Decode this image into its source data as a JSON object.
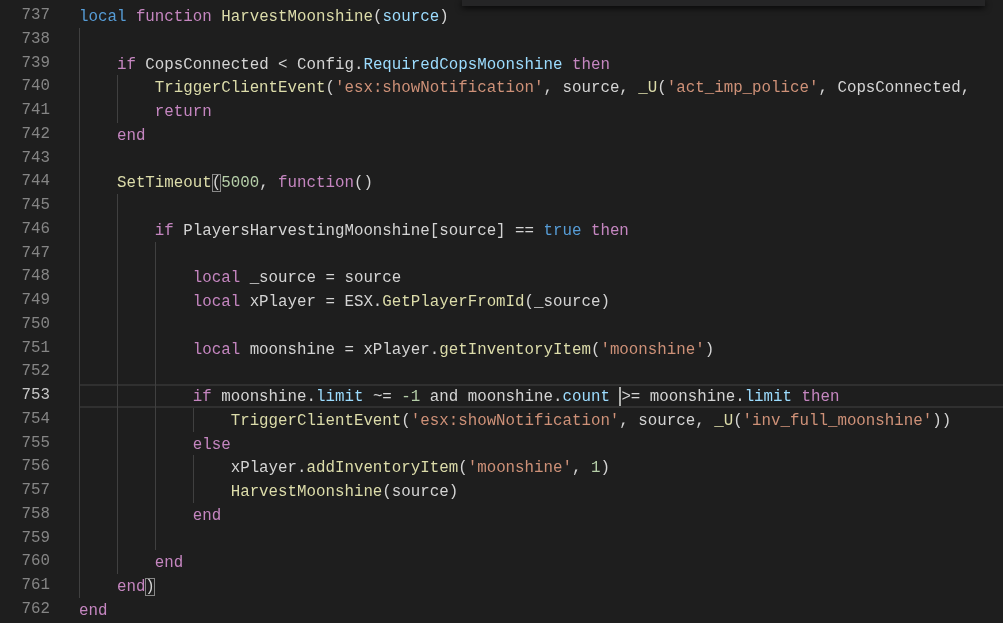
{
  "editor": {
    "lines": [
      {
        "number": "737",
        "current": false,
        "tokens": [
          {
            "text": "local ",
            "kind": "storage"
          },
          {
            "text": "function ",
            "kind": "kw"
          },
          {
            "text": "HarvestMoonshine",
            "kind": "fn"
          },
          {
            "text": "(",
            "kind": "plain"
          },
          {
            "text": "source",
            "kind": "prop"
          },
          {
            "text": ")",
            "kind": "plain"
          }
        ]
      },
      {
        "number": "738",
        "current": false
      },
      {
        "number": "739",
        "current": false,
        "tokens": [
          {
            "text": "    if",
            "kind": "kw"
          },
          {
            "text": " CopsConnected < Config.",
            "kind": "plain"
          },
          {
            "text": "RequiredCopsMoonshine",
            "kind": "prop"
          },
          {
            "text": " then",
            "kind": "kw"
          }
        ]
      },
      {
        "number": "740",
        "current": false,
        "tokens": [
          {
            "text": "        TriggerClientEvent",
            "kind": "fn"
          },
          {
            "text": "(",
            "kind": "plain"
          },
          {
            "text": "'esx:showNotification'",
            "kind": "str"
          },
          {
            "text": ", source, ",
            "kind": "plain"
          },
          {
            "text": "_U",
            "kind": "fn"
          },
          {
            "text": "(",
            "kind": "plain"
          },
          {
            "text": "'act_imp_police'",
            "kind": "str"
          },
          {
            "text": ", CopsConnected,",
            "kind": "plain"
          }
        ]
      },
      {
        "number": "741",
        "current": false,
        "tokens": [
          {
            "text": "        return",
            "kind": "kw"
          }
        ]
      },
      {
        "number": "742",
        "current": false,
        "tokens": [
          {
            "text": "    end",
            "kind": "kw"
          }
        ]
      },
      {
        "number": "743",
        "current": false
      },
      {
        "number": "744",
        "current": false,
        "tokens": [
          {
            "text": "    SetTimeout",
            "kind": "fn"
          },
          {
            "text": "(",
            "kind": "bracket"
          },
          {
            "text": "5000",
            "kind": "num"
          },
          {
            "text": ", ",
            "kind": "plain"
          },
          {
            "text": "function",
            "kind": "kw"
          },
          {
            "text": "()",
            "kind": "plain"
          }
        ]
      },
      {
        "number": "745",
        "current": false
      },
      {
        "number": "746",
        "current": false,
        "tokens": [
          {
            "text": "        if",
            "kind": "kw"
          },
          {
            "text": " PlayersHarvestingMoonshine[source] == ",
            "kind": "plain"
          },
          {
            "text": "true",
            "kind": "storage"
          },
          {
            "text": " then",
            "kind": "kw"
          }
        ]
      },
      {
        "number": "747",
        "current": false
      },
      {
        "number": "748",
        "current": false,
        "tokens": [
          {
            "text": "            local",
            "kind": "kw"
          },
          {
            "text": " _source = source",
            "kind": "plain"
          }
        ]
      },
      {
        "number": "749",
        "current": false,
        "tokens": [
          {
            "text": "            local",
            "kind": "kw"
          },
          {
            "text": " xPlayer = ESX.",
            "kind": "plain"
          },
          {
            "text": "GetPlayerFromId",
            "kind": "fn"
          },
          {
            "text": "(_source)",
            "kind": "plain"
          }
        ]
      },
      {
        "number": "750",
        "current": false
      },
      {
        "number": "751",
        "current": false,
        "tokens": [
          {
            "text": "            local",
            "kind": "kw"
          },
          {
            "text": " moonshine = xPlayer.",
            "kind": "plain"
          },
          {
            "text": "getInventoryItem",
            "kind": "fn"
          },
          {
            "text": "(",
            "kind": "plain"
          },
          {
            "text": "'moonshine'",
            "kind": "str"
          },
          {
            "text": ")",
            "kind": "plain"
          }
        ]
      },
      {
        "number": "752",
        "current": false
      },
      {
        "number": "753",
        "current": true,
        "tokens": [
          {
            "text": "            if",
            "kind": "kw"
          },
          {
            "text": " moonshine.",
            "kind": "plain"
          },
          {
            "text": "limit",
            "kind": "prop"
          },
          {
            "text": " ~= ",
            "kind": "plain"
          },
          {
            "text": "-1",
            "kind": "num"
          },
          {
            "text": " and moonshine.",
            "kind": "plain"
          },
          {
            "text": "count ",
            "kind": "prop"
          },
          {
            "kind": "cursor"
          },
          {
            "text": ">= moonshine.",
            "kind": "plain"
          },
          {
            "text": "limit",
            "kind": "prop"
          },
          {
            "text": " then",
            "kind": "kw"
          }
        ]
      },
      {
        "number": "754",
        "current": false,
        "tokens": [
          {
            "text": "                TriggerClientEvent",
            "kind": "fn"
          },
          {
            "text": "(",
            "kind": "plain"
          },
          {
            "text": "'esx:showNotification'",
            "kind": "str"
          },
          {
            "text": ", source, ",
            "kind": "plain"
          },
          {
            "text": "_U",
            "kind": "fn"
          },
          {
            "text": "(",
            "kind": "plain"
          },
          {
            "text": "'inv_full_moonshine'",
            "kind": "str"
          },
          {
            "text": "))",
            "kind": "plain"
          }
        ]
      },
      {
        "number": "755",
        "current": false,
        "tokens": [
          {
            "text": "            else",
            "kind": "kw"
          }
        ]
      },
      {
        "number": "756",
        "current": false,
        "tokens": [
          {
            "text": "                xPlayer.",
            "kind": "plain"
          },
          {
            "text": "addInventoryItem",
            "kind": "fn"
          },
          {
            "text": "(",
            "kind": "plain"
          },
          {
            "text": "'moonshine'",
            "kind": "str"
          },
          {
            "text": ", ",
            "kind": "plain"
          },
          {
            "text": "1",
            "kind": "num"
          },
          {
            "text": ")",
            "kind": "plain"
          }
        ]
      },
      {
        "number": "757",
        "current": false,
        "tokens": [
          {
            "text": "                HarvestMoonshine",
            "kind": "fn"
          },
          {
            "text": "(source)",
            "kind": "plain"
          }
        ]
      },
      {
        "number": "758",
        "current": false,
        "tokens": [
          {
            "text": "            end",
            "kind": "kw"
          }
        ]
      },
      {
        "number": "759",
        "current": false
      },
      {
        "number": "760",
        "current": false,
        "tokens": [
          {
            "text": "        end",
            "kind": "kw"
          }
        ]
      },
      {
        "number": "761",
        "current": false,
        "tokens": [
          {
            "text": "    end",
            "kind": "kw"
          },
          {
            "text": ")",
            "kind": "bracket"
          }
        ]
      },
      {
        "number": "762",
        "current": false,
        "tokens": [
          {
            "text": "end",
            "kind": "kw"
          }
        ]
      }
    ]
  }
}
